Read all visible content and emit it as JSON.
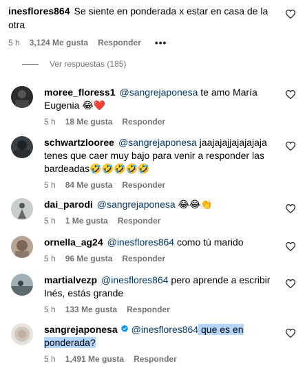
{
  "top_comment": {
    "username": "inesflores864",
    "text": "Se siente en ponderada x estar en casa de la otra",
    "time": "5 h",
    "likes": "3,124 Me gusta",
    "reply_label": "Responder",
    "more": "•••"
  },
  "view_replies": "Ver respuestas (185)",
  "replies": [
    {
      "username": "moree_floress1",
      "mention": "@sangrejaponesa",
      "text": " te amo María Eugenia 😂❤️",
      "time": "5 h",
      "likes": "18 Me gusta",
      "reply_label": "Responder",
      "avatar_color": "#2b2b2b"
    },
    {
      "username": "schwartzlooree",
      "mention": "@sangrejaponesa",
      "text": " jaajajajjajajajaja tenes que caer muy bajo para venir a responder las bardeadas🤣🤣🤣🤣🤣",
      "time": "5 h",
      "likes": "84 Me gusta",
      "reply_label": "Responder",
      "avatar_color": "#3a3f44"
    },
    {
      "username": "dai_parodi",
      "mention": "@sangrejaponesa",
      "text": " 😂😂👏",
      "time": "5 h",
      "likes": "1 Me gusta",
      "reply_label": "Responder",
      "avatar_color": "#9aa0a0"
    },
    {
      "username": "ornella_ag24",
      "mention": "@inesflores864",
      "text": " como tú marido",
      "time": "5 h",
      "likes": "96 Me gusta",
      "reply_label": "Responder",
      "avatar_color": "#a08a7a"
    },
    {
      "username": "martialvezp",
      "mention": "@inesflores864",
      "text": " pero aprende a escribir Inés, estás grande",
      "time": "5 h",
      "likes": "133 Me gusta",
      "reply_label": "Responder",
      "avatar_color": "#6d7a7f"
    },
    {
      "username": "sangrejaponesa",
      "mention": "@inesflores864",
      "text_highlight": " que es en ponderada?",
      "verified": true,
      "time": "5 h",
      "likes": "1,491 Me gusta",
      "reply_label": "Responder",
      "avatar_color": "#d8cfc8"
    }
  ],
  "colors": {
    "mention": "#00376b",
    "meta": "#737373",
    "highlight": "#b4d5fe",
    "verified": "#0095f6"
  }
}
